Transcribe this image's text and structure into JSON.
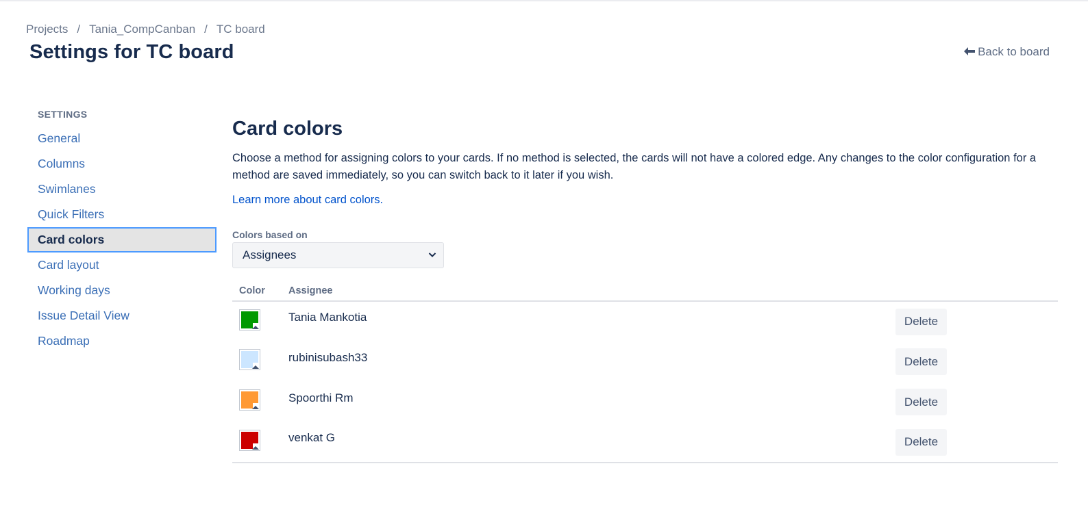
{
  "breadcrumb": {
    "items": [
      "Projects",
      "Tania_CompCanban",
      "TC board"
    ],
    "separator": "/"
  },
  "page_title": "Settings for TC board",
  "back_link": {
    "label": "Back to board",
    "icon": "left-arrow-icon"
  },
  "sidebar": {
    "heading": "SETTINGS",
    "items": [
      {
        "label": "General"
      },
      {
        "label": "Columns"
      },
      {
        "label": "Swimlanes"
      },
      {
        "label": "Quick Filters"
      },
      {
        "label": "Card colors",
        "active": true
      },
      {
        "label": "Card layout"
      },
      {
        "label": "Working days"
      },
      {
        "label": "Issue Detail View"
      },
      {
        "label": "Roadmap"
      }
    ]
  },
  "main": {
    "title": "Card colors",
    "description": "Choose a method for assigning colors to your cards. If no method is selected, the cards will not have a colored edge. Any changes to the color configuration for a method are saved immediately, so you can switch back to it later if you wish.",
    "learn_more": "Learn more about card colors.",
    "colors_based_on": {
      "label": "Colors based on",
      "selected": "Assignees"
    },
    "table": {
      "headers": {
        "color": "Color",
        "assignee": "Assignee"
      },
      "rows": [
        {
          "assignee": "Tania Mankotia",
          "color": "#009900",
          "action": "Delete"
        },
        {
          "assignee": "rubinisubash33",
          "color": "#cce6ff",
          "action": "Delete"
        },
        {
          "assignee": "Spoorthi Rm",
          "color": "#ff9933",
          "action": "Delete"
        },
        {
          "assignee": "venkat G",
          "color": "#cc0000",
          "action": "Delete"
        }
      ]
    }
  },
  "colors": {
    "link": "#0052cc",
    "active_border": "#4c9aff",
    "text": "#172b4d"
  }
}
